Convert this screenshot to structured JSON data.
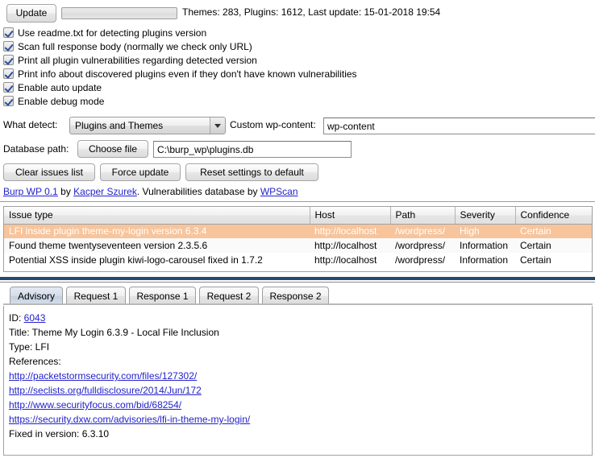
{
  "toolbar": {
    "update_label": "Update",
    "progress_value": 0,
    "status_text": "Themes: 283, Plugins: 1612, Last update: 15-01-2018 19:54"
  },
  "options": [
    {
      "label": "Use readme.txt for detecting plugins version",
      "checked": true
    },
    {
      "label": "Scan full response body (normally we check only URL)",
      "checked": true
    },
    {
      "label": "Print all plugin vulnerabilities regarding detected version",
      "checked": true
    },
    {
      "label": "Print info about discovered plugins even if they don't have known vulnerabilities",
      "checked": true
    },
    {
      "label": "Enable auto update",
      "checked": true
    },
    {
      "label": "Enable debug mode",
      "checked": true
    }
  ],
  "detect": {
    "label": "What detect:",
    "selected": "Plugins and Themes",
    "wpcontent_label": "Custom wp-content:",
    "wpcontent_value": "wp-content",
    "wpcontent_placeholder": "wp-content"
  },
  "database": {
    "label": "Database path:",
    "choose_label": "Choose file",
    "path_value": "C:\\burp_wp\\plugins.db",
    "path_placeholder": "C:\\burp_wp\\plugins.db"
  },
  "actions": {
    "clear_label": "Clear issues list",
    "force_label": "Force update",
    "reset_label": "Reset settings to default"
  },
  "credit": {
    "app_link": "Burp WP 0.1",
    "by_text": " by ",
    "author_link": "Kacper Szurek",
    "mid_text": ". Vulnerabilities database by ",
    "db_link": "WPScan"
  },
  "issues": {
    "columns": [
      "Issue type",
      "Host",
      "Path",
      "Severity",
      "Confidence"
    ],
    "rows": [
      {
        "issue": "LFI inside plugin theme-my-login version 6.3.4",
        "host": "http://localhost",
        "path": "/wordpress/",
        "severity": "High",
        "confidence": "Certain",
        "selected": true
      },
      {
        "issue": "Found theme twentyseventeen version 2.3.5.6",
        "host": "http://localhost",
        "path": "/wordpress/",
        "severity": "Information",
        "confidence": "Certain",
        "selected": false
      },
      {
        "issue": "Potential XSS inside plugin kiwi-logo-carousel fixed in 1.7.2",
        "host": "http://localhost",
        "path": "/wordpress/",
        "severity": "Information",
        "confidence": "Certain",
        "selected": false
      }
    ]
  },
  "tabs": [
    {
      "label": "Advisory",
      "active": true
    },
    {
      "label": "Request 1",
      "active": false
    },
    {
      "label": "Response 1",
      "active": false
    },
    {
      "label": "Request 2",
      "active": false
    },
    {
      "label": "Response 2",
      "active": false
    }
  ],
  "advisory": {
    "id_label": "ID: ",
    "id_value": "6043",
    "title_line": "Title: Theme My Login 6.3.9 - Local File Inclusion",
    "type_line": "Type: LFI",
    "references_label": "References:",
    "references": [
      "http://packetstormsecurity.com/files/127302/",
      "http://seclists.org/fulldisclosure/2014/Jun/172",
      "http://www.securityfocus.com/bid/68254/",
      "https://security.dxw.com/advisories/lfi-in-theme-my-login/"
    ],
    "fixed_line": "Fixed in version: 6.3.10"
  },
  "colors": {
    "selection": "#f8c49b",
    "link": "#2222cc",
    "accent": "#27496d"
  }
}
